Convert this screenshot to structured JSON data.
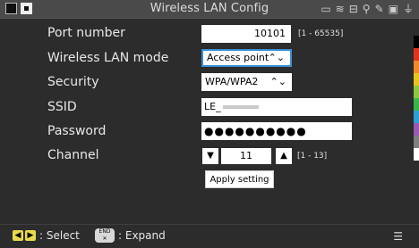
{
  "window": {
    "title": "Wireless LAN Config"
  },
  "statusbar": {
    "icons": [
      "battery-icon",
      "wifi-icon",
      "network-icon",
      "usb-icon",
      "tool-icon",
      "lock-icon",
      "plug-icon"
    ]
  },
  "form": {
    "port": {
      "label": "Port number",
      "value": "10101",
      "range": "[1 - 65535]"
    },
    "mode": {
      "label": "Wireless LAN mode",
      "value": "Access point"
    },
    "security": {
      "label": "Security",
      "value": "WPA/WPA2"
    },
    "ssid": {
      "label": "SSID",
      "value": "LE_"
    },
    "password": {
      "label": "Password",
      "value": "●●●●●●●●●●"
    },
    "channel": {
      "label": "Channel",
      "value": "11",
      "range": "[1 - 13]"
    },
    "apply_label": "Apply setting"
  },
  "footer": {
    "select_label": ": Select",
    "expand_label": ": Expand",
    "end_key_top": "END",
    "end_key_bottom": "✕"
  },
  "colors": {
    "accent": "#3a8fd6",
    "strip": [
      "#000000",
      "#e2341d",
      "#f08a2a",
      "#e6c51f",
      "#8dc63f",
      "#3ab54a",
      "#2aa0d4",
      "#9b59b6",
      "#7f7f7f",
      "#ffffff"
    ]
  }
}
